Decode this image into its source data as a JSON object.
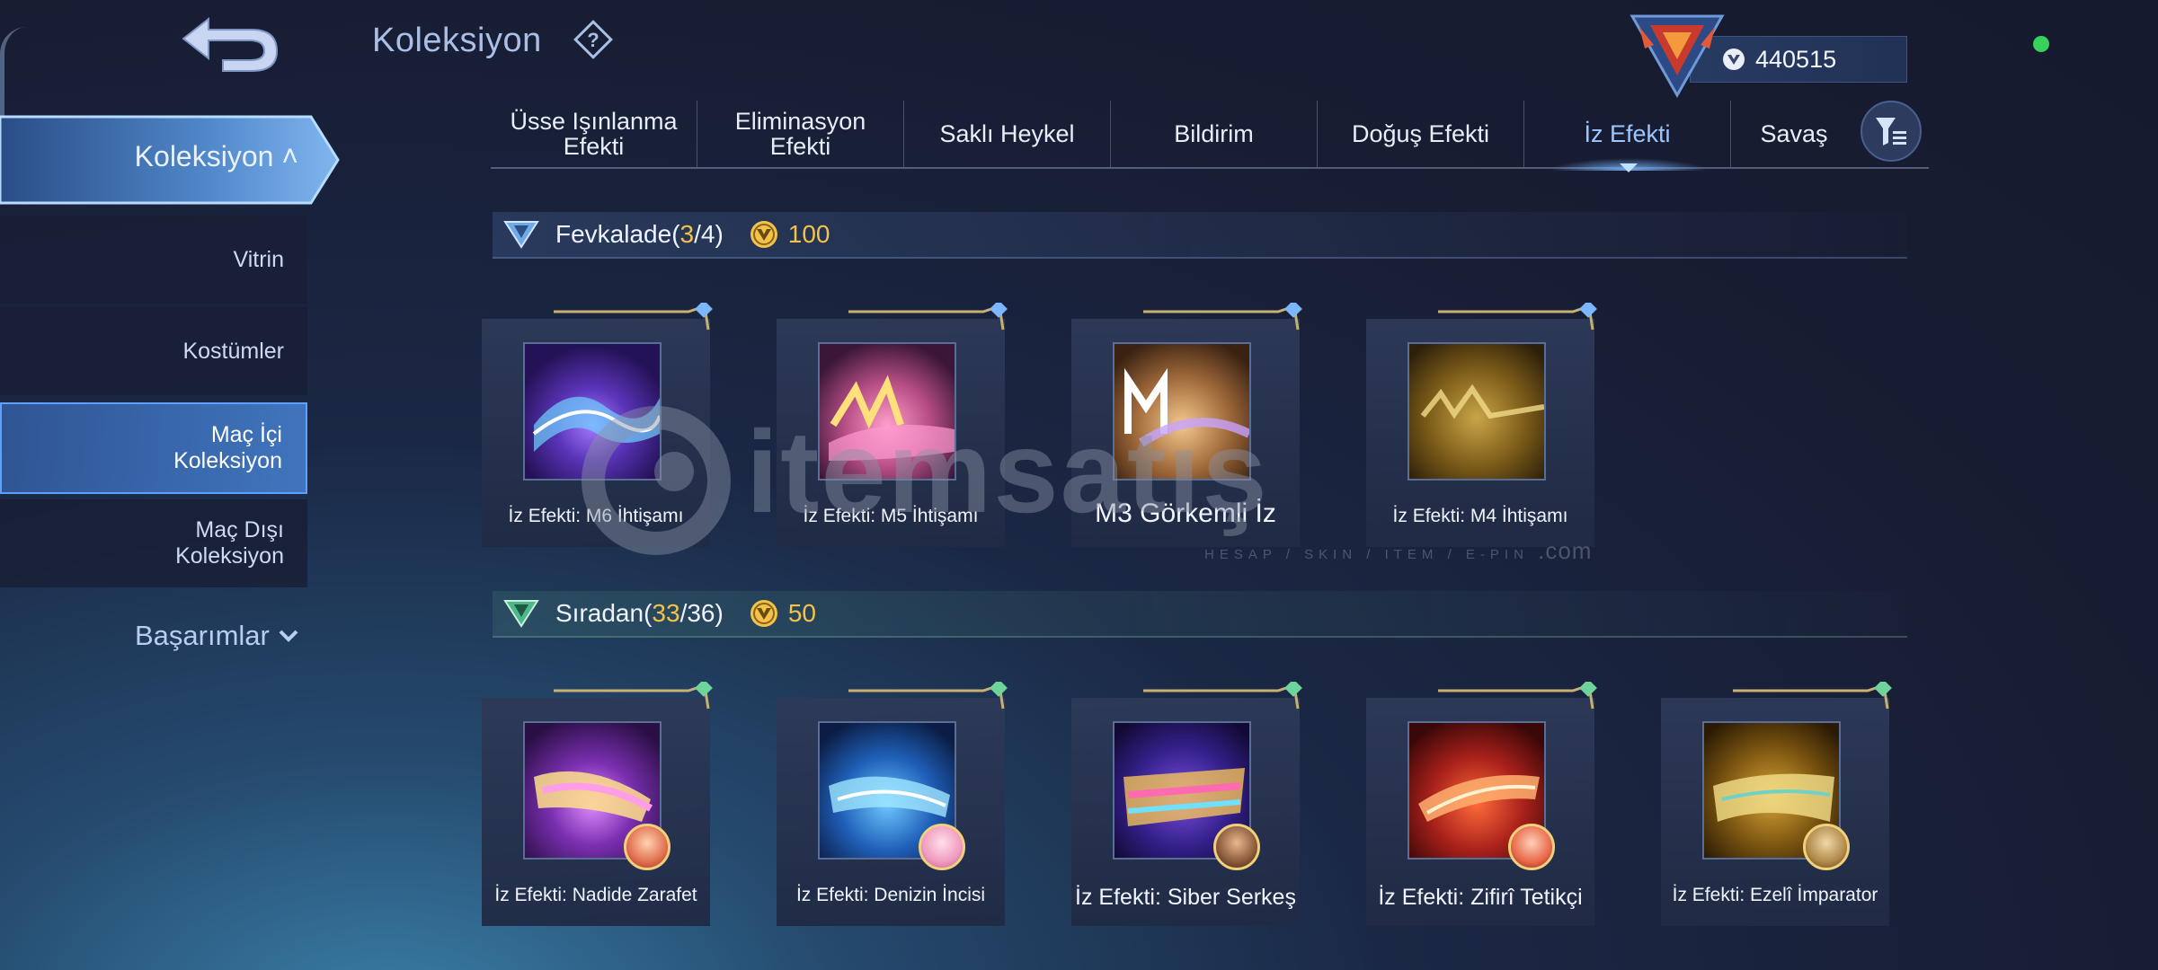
{
  "header": {
    "title": "Koleksiyon",
    "currency_value": "440515"
  },
  "sidebar": {
    "main_label": "Koleksiyon",
    "items": [
      {
        "label": "Vitrin"
      },
      {
        "label": "Kostümler"
      },
      {
        "label": "Maç İçi Koleksiyon",
        "line1": "Maç İçi",
        "line2": "Koleksiyon"
      },
      {
        "label": "Maç Dışı Koleksiyon",
        "line1": "Maç Dışı",
        "line2": "Koleksiyon"
      }
    ],
    "achievements_label": "Başarımlar"
  },
  "tabs": [
    {
      "line1": "Üsse Işınlanma",
      "line2": "Efekti"
    },
    {
      "line1": "Eliminasyon",
      "line2": "Efekti"
    },
    {
      "line1": "Saklı Heykel",
      "line2": ""
    },
    {
      "line1": "Bildirim",
      "line2": ""
    },
    {
      "line1": "Doğuş Efekti",
      "line2": ""
    },
    {
      "line1": "İz Efekti",
      "line2": ""
    },
    {
      "line1": "Savaş",
      "line2": ""
    }
  ],
  "active_tab": "İz Efekti",
  "sections": [
    {
      "title": "Fevkalade",
      "count_open": "(",
      "owned": "3",
      "slash": "/",
      "total": "4",
      "count_close": ")",
      "price": "100",
      "cards": [
        {
          "name": "İz Efekti: M6 İhtişamı"
        },
        {
          "name": "İz Efekti: M5 İhtişamı"
        },
        {
          "name": "M3 Görkemli İz"
        },
        {
          "name": "İz Efekti: M4 İhtişamı"
        }
      ]
    },
    {
      "title": "Sıradan",
      "count_open": "(",
      "owned": "33",
      "slash": "/",
      "total": "36",
      "count_close": ")",
      "price": "50",
      "cards": [
        {
          "name": "İz Efekti: Nadide Zarafet"
        },
        {
          "name": "İz Efekti: Denizin İncisi"
        },
        {
          "name": "İz Efekti: Siber Serkeş"
        },
        {
          "name": "İz Efekti: Zifirî Tetikçi"
        },
        {
          "name": "İz Efekti: Ezelî İmparator"
        }
      ]
    }
  ],
  "watermark": {
    "text": "itemsatış",
    "sub": "HESAP / SKIN / ITEM / E-PIN",
    "dotcom": ".com"
  },
  "colors": {
    "accent_gold": "#f3c24a",
    "accent_blue": "#5ea0ff",
    "status_green": "#38d15c"
  }
}
